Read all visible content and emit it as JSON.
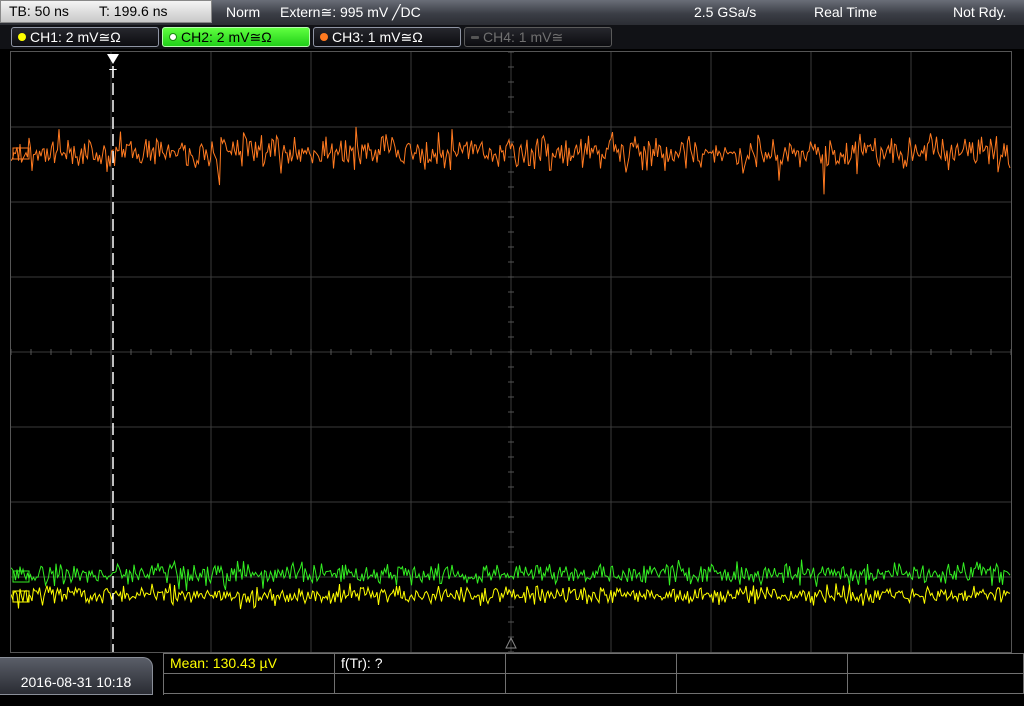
{
  "header": {
    "timebase": "TB: 50 ns",
    "trigger_time": "T: 199.6 ns",
    "mode": "Norm",
    "trigger_source": "Extern≅: 995 mV ╱DC",
    "sample_rate": "2.5 GSa/s",
    "acq_mode": "Real Time",
    "status": "Not Rdy."
  },
  "channels": [
    {
      "label": "CH1: 2 mV≅Ω",
      "color": "#ffff00",
      "state": "on"
    },
    {
      "label": "CH2: 2 mV≅Ω",
      "color": "#33ee22",
      "state": "active"
    },
    {
      "label": "CH3: 1 mV≅Ω",
      "color": "#ff7a20",
      "state": "on"
    },
    {
      "label": "CH4: 1 mV≅",
      "color": "#666666",
      "state": "off"
    }
  ],
  "markers": {
    "trigger_symbol": "T"
  },
  "footer": {
    "datetime": "2016-08-31 10:18",
    "measurement_1": "Mean: 130.43 µV",
    "measurement_2": "f(Tr): ?"
  },
  "colors": {
    "ch1": "#ffff00",
    "ch2": "#33ee22",
    "ch3": "#ff7a20",
    "grid": "#3a3a3a",
    "measurement": "#ffff00"
  }
}
